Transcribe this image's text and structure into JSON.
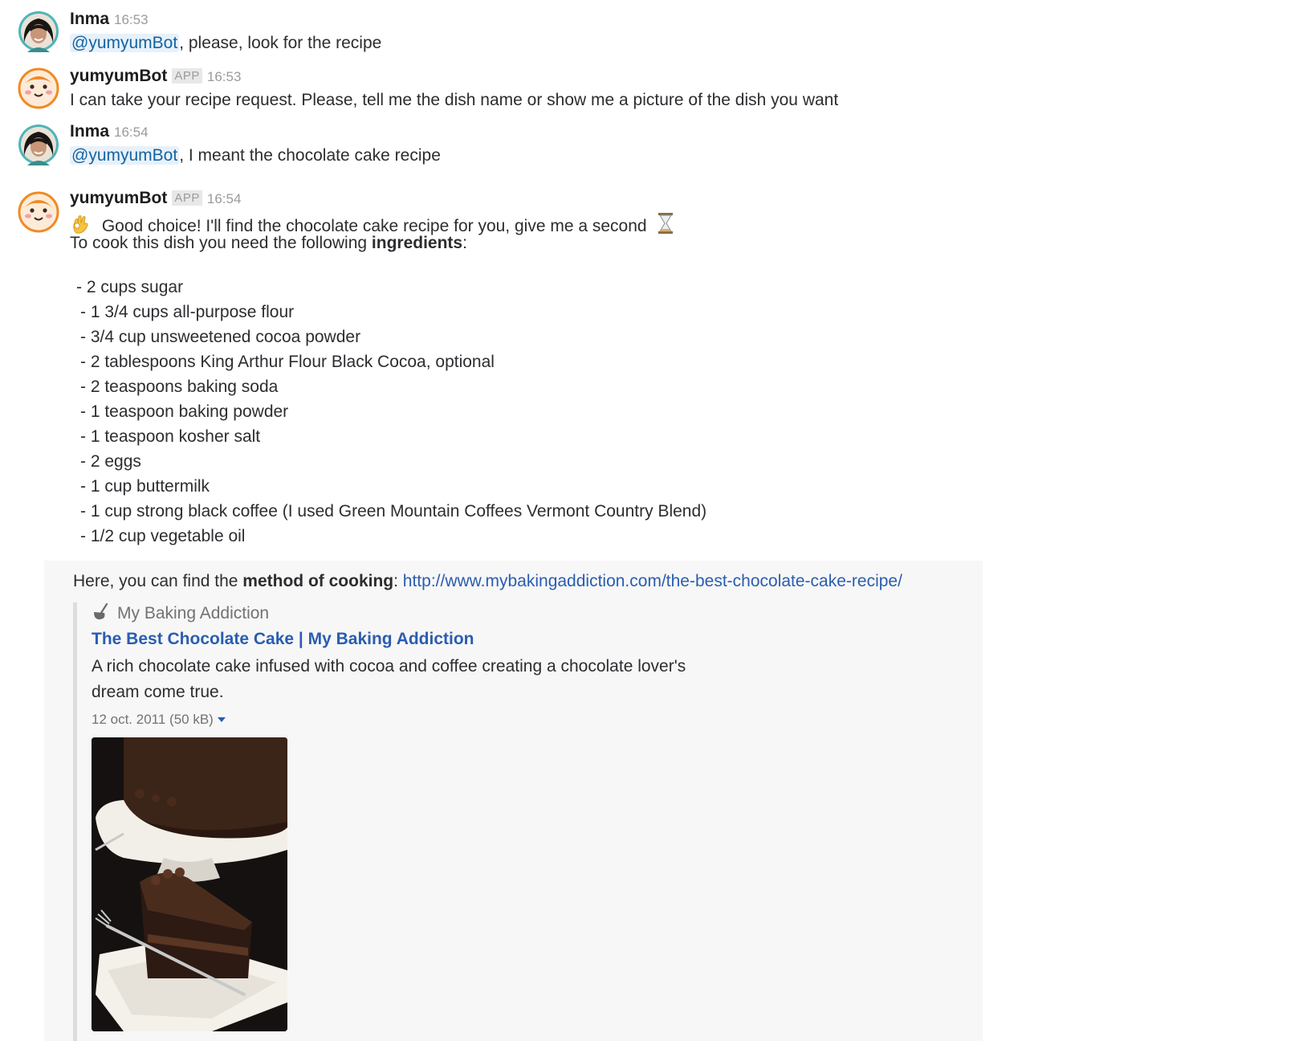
{
  "messages": [
    {
      "sender": "Inma",
      "time": "16:53",
      "mention": "@yumyumBot",
      "text": ", please, look for the recipe"
    },
    {
      "sender": "yumyumBot",
      "badge": "APP",
      "time": "16:53",
      "text": "I can take your recipe request. Please, tell me the dish name or show me a picture of the dish you want"
    },
    {
      "sender": "Inma",
      "time": "16:54",
      "mention": "@yumyumBot",
      "text": ", I meant the chocolate cake recipe"
    },
    {
      "sender": "yumyumBot",
      "badge": "APP",
      "time": "16:54",
      "text": "Good choice! I'll find the chocolate cake recipe for you, give me a second",
      "intro_pre": "To cook this dish you need the following ",
      "intro_bold": "ingredients",
      "intro_post": ":"
    }
  ],
  "ingredients": [
    "- 2 cups sugar",
    "- 1 3/4 cups all-purpose flour",
    "- 3/4 cup unsweetened cocoa powder",
    "- 2 tablespoons King Arthur Flour Black Cocoa, optional",
    "- 2 teaspoons baking soda",
    "- 1 teaspoon baking powder",
    "- 1 teaspoon kosher salt",
    "- 2 eggs",
    "- 1 cup buttermilk",
    "- 1 cup strong black coffee (I used Green Mountain Coffees Vermont Country Blend)",
    "- 1/2 cup vegetable oil"
  ],
  "method": {
    "pre": "Here, you can find the ",
    "bold": "method of cooking",
    "post": ": ",
    "url": "http://www.mybakingaddiction.com/the-best-chocolate-cake-recipe/"
  },
  "attachment": {
    "site": "My Baking Addiction",
    "title": "The Best Chocolate Cake | My Baking Addiction",
    "description": "A rich chocolate cake infused with cocoa and coffee creating a chocolate lover's dream come true.",
    "meta": "12 oct. 2011 (50 kB)"
  },
  "icons": {
    "ok_hand": "ok-hand-icon",
    "hourglass": "hourglass-icon",
    "ladle": "ladle-icon"
  },
  "colors": {
    "link": "#2a5db0",
    "mention": "#1264a3",
    "mention_bg": "#e8f1fa",
    "attachment_bg": "#f7f7f7"
  }
}
